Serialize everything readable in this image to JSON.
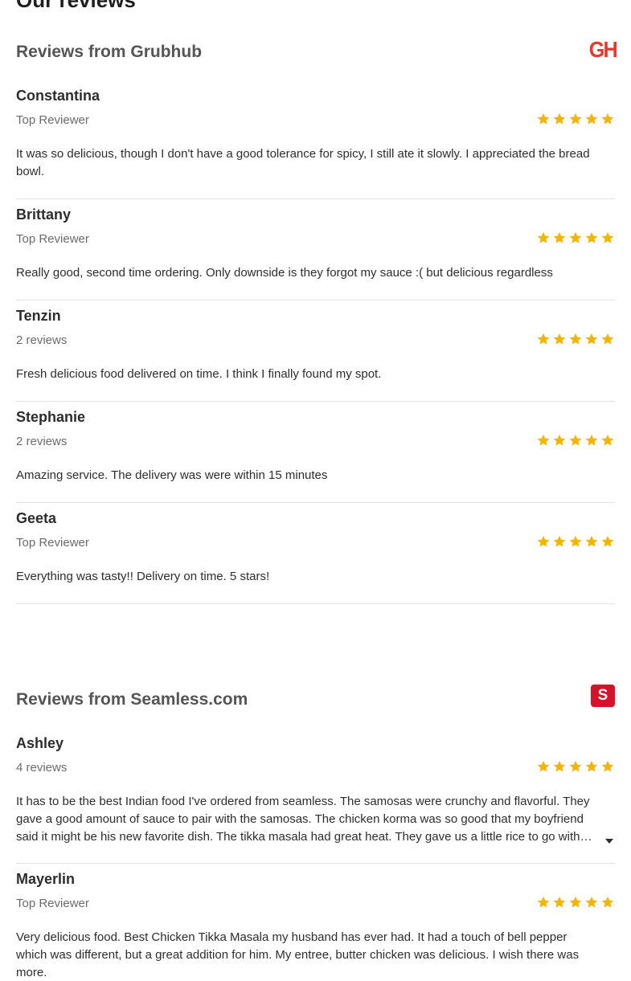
{
  "page_title": "Our reviews",
  "sections": [
    {
      "title": "Reviews from Grubhub",
      "logo_text": "GH",
      "reviews": [
        {
          "name": "Constantina",
          "meta": "Top Reviewer",
          "rating": 5,
          "text": "It was so delicious, though I don't have a good tolerance for spicy, I still ate it slowly. I appreciated the bread bowl."
        },
        {
          "name": "Brittany",
          "meta": "Top Reviewer",
          "rating": 5,
          "text": "Really good, second time ordering. Only downside is they forgot my sauce :( but delicious regardless"
        },
        {
          "name": "Tenzin",
          "meta": "2 reviews",
          "rating": 5,
          "text": "Fresh delicious food delivered on time. I think I finally found my spot."
        },
        {
          "name": "Stephanie",
          "meta": "2 reviews",
          "rating": 5,
          "text": "Amazing service. The delivery was were within 15 minutes"
        },
        {
          "name": "Geeta",
          "meta": "Top Reviewer",
          "rating": 5,
          "text": "Everything was tasty!! Delivery on time. 5 stars!"
        }
      ]
    },
    {
      "title": "Reviews from Seamless.com",
      "logo_text": "S",
      "reviews": [
        {
          "name": "Ashley",
          "meta": "4 reviews",
          "rating": 5,
          "text": "It has to be the best Indian food I've ordered from seamless. The samosas were crunchy and flavorful. They gave a good amount of sauce to pair with the samosas. The chicken korma was so good that my boyfriend said it might be his new favorite dish. The tikka masala had great heat. They gave us a little rice to go with everything."
        },
        {
          "name": "Mayerlin",
          "meta": "Top Reviewer",
          "rating": 5,
          "text": "Very delicious food. Best Chicken Tikka Masala my husband has ever had. It had a touch of bell pepper which was different, but a great addition for him. My entree, butter chicken was delicious. I wish there was more."
        }
      ]
    }
  ],
  "colors": {
    "star": "#f5b400",
    "grubhub_brand": "#e23b2f",
    "seamless_brand": "#d6112a",
    "divider": "#e3e3e3"
  },
  "icons": {
    "star": "star-icon",
    "expand": "caret-down-icon"
  }
}
